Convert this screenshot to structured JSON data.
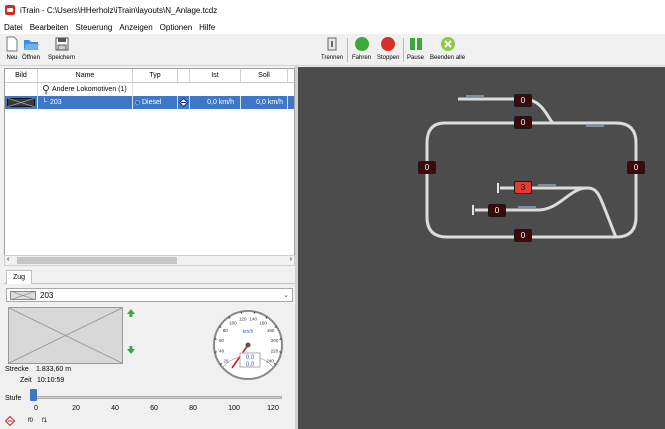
{
  "window": {
    "title": "iTrain - C:\\Users\\HHerholz\\iTrain\\layouts\\N_Anlage.tcdz"
  },
  "menu": [
    "Datei",
    "Bearbeiten",
    "Steuerung",
    "Anzeigen",
    "Optionen",
    "Hilfe"
  ],
  "toolbar_left": {
    "new": "Neu",
    "open": "Öffnen",
    "save": "Speichern"
  },
  "toolbar_right": {
    "disconnect": "Trennen",
    "go": "Fahren",
    "stop": "Stoppen",
    "pause": "Pause",
    "end_all": "Beenden alle"
  },
  "table": {
    "headers": [
      "Bild",
      "Name",
      "Typ",
      "Ist",
      "Soll"
    ],
    "group": "Andere Lokomotiven (1)",
    "row": {
      "name": "203",
      "type": "Diesel",
      "ist": "0,0 km/h",
      "soll": "0,0 km/h"
    }
  },
  "panel": {
    "tab": "Zug",
    "selected_loco": "203",
    "strecke_label": "Strecke",
    "strecke_value": "1.833,60 m",
    "zeit_label": "Zeit",
    "zeit_value": "10:10:59",
    "stufe_label": "Stufe",
    "ticks": [
      "0",
      "20",
      "40",
      "60",
      "80",
      "100",
      "120"
    ],
    "functions": [
      "f0",
      "f1"
    ]
  },
  "gauge": {
    "unit": "km/h",
    "ticks": [
      "20",
      "40",
      "60",
      "80",
      "100",
      "120",
      "140",
      "160",
      "180",
      "200",
      "220",
      "240"
    ],
    "readout_top": "0,0",
    "readout_bottom": "0,0",
    "speed": 0
  },
  "layout": {
    "signals": [
      "0",
      "0",
      "0",
      "0",
      "3",
      "0",
      "0"
    ],
    "colors": {
      "background": "#4c4c4c",
      "track": "#dcdcdc",
      "signal_off": "#3a0b08",
      "signal_on": "#e43b32"
    }
  }
}
